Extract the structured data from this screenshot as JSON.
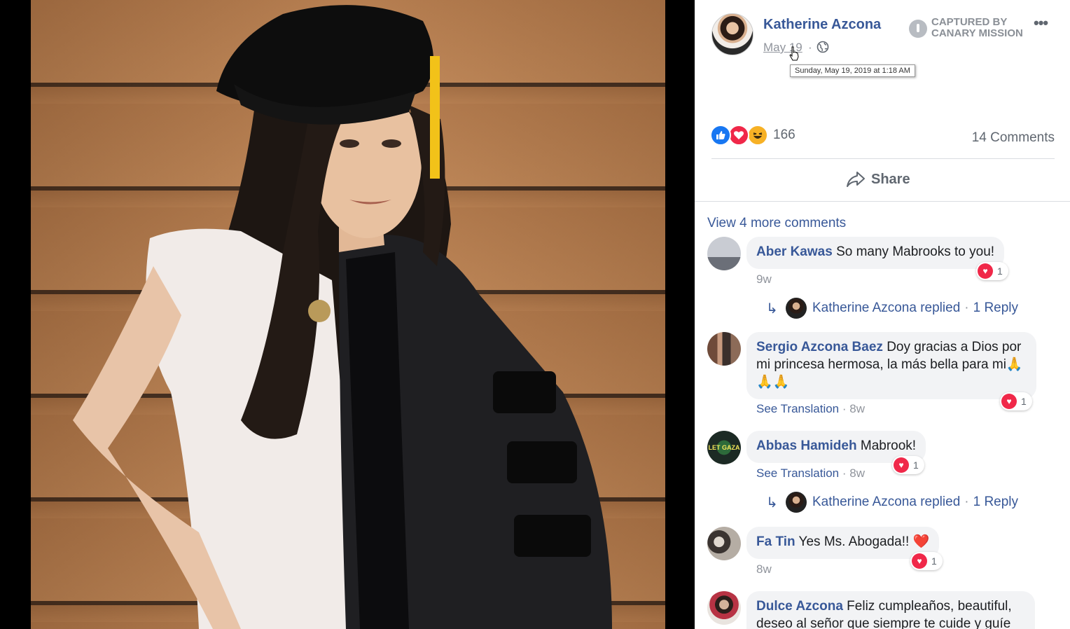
{
  "post": {
    "author": "Katherine Azcona",
    "date": "May 19",
    "meta_separator": "·",
    "tooltip": "Sunday, May 19, 2019 at 1:18 AM",
    "watermark_line1": "CAPTURED BY",
    "watermark_line2": "CANARY MISSION",
    "more_icon": "•••",
    "reaction_count": "166",
    "comment_count": "14 Comments",
    "share_label": "Share"
  },
  "icons": {
    "like": "like-icon",
    "love": "love-icon",
    "haha": "haha-icon",
    "share": "share-icon",
    "globe": "globe-icon",
    "cursor": "cursor-hand-icon",
    "reply": "reply-arrow-icon"
  },
  "colors": {
    "link": "#385898",
    "like": "#1877f2",
    "love": "#f02849",
    "haha": "#f7b125",
    "bubble": "#f2f3f5",
    "meta": "#90949c"
  },
  "comments": {
    "view_more": "View 4 more comments",
    "items": [
      {
        "author": "Aber Kawas",
        "text": "So many Mabrooks to you!",
        "heart_count": "1",
        "time": "9w",
        "reply_label": "Katherine Azcona replied",
        "reply_sep": "·",
        "reply_count": "1 Reply"
      },
      {
        "author": "Sergio Azcona Baez",
        "text": "Doy gracias a Dios por mi princesa hermosa, la más bella para mi🙏🙏🙏",
        "heart_count": "1",
        "translation": "See Translation",
        "time": "· 8w"
      },
      {
        "author": "Abbas Hamideh",
        "text": "Mabrook!",
        "heart_count": "1",
        "translation": "See Translation",
        "time": "· 8w",
        "reply_label": "Katherine Azcona replied",
        "reply_sep": "·",
        "reply_count": "1 Reply",
        "avatar_text": "LET GAZA"
      },
      {
        "author": "Fa Tin",
        "text": "Yes Ms. Abogada!! ❤️",
        "heart_count": "1",
        "time": "8w"
      },
      {
        "author": "Dulce Azcona",
        "text": "Feliz cumpleaños, beautiful, deseo al señor que siempre te cuide y guíe"
      }
    ]
  }
}
